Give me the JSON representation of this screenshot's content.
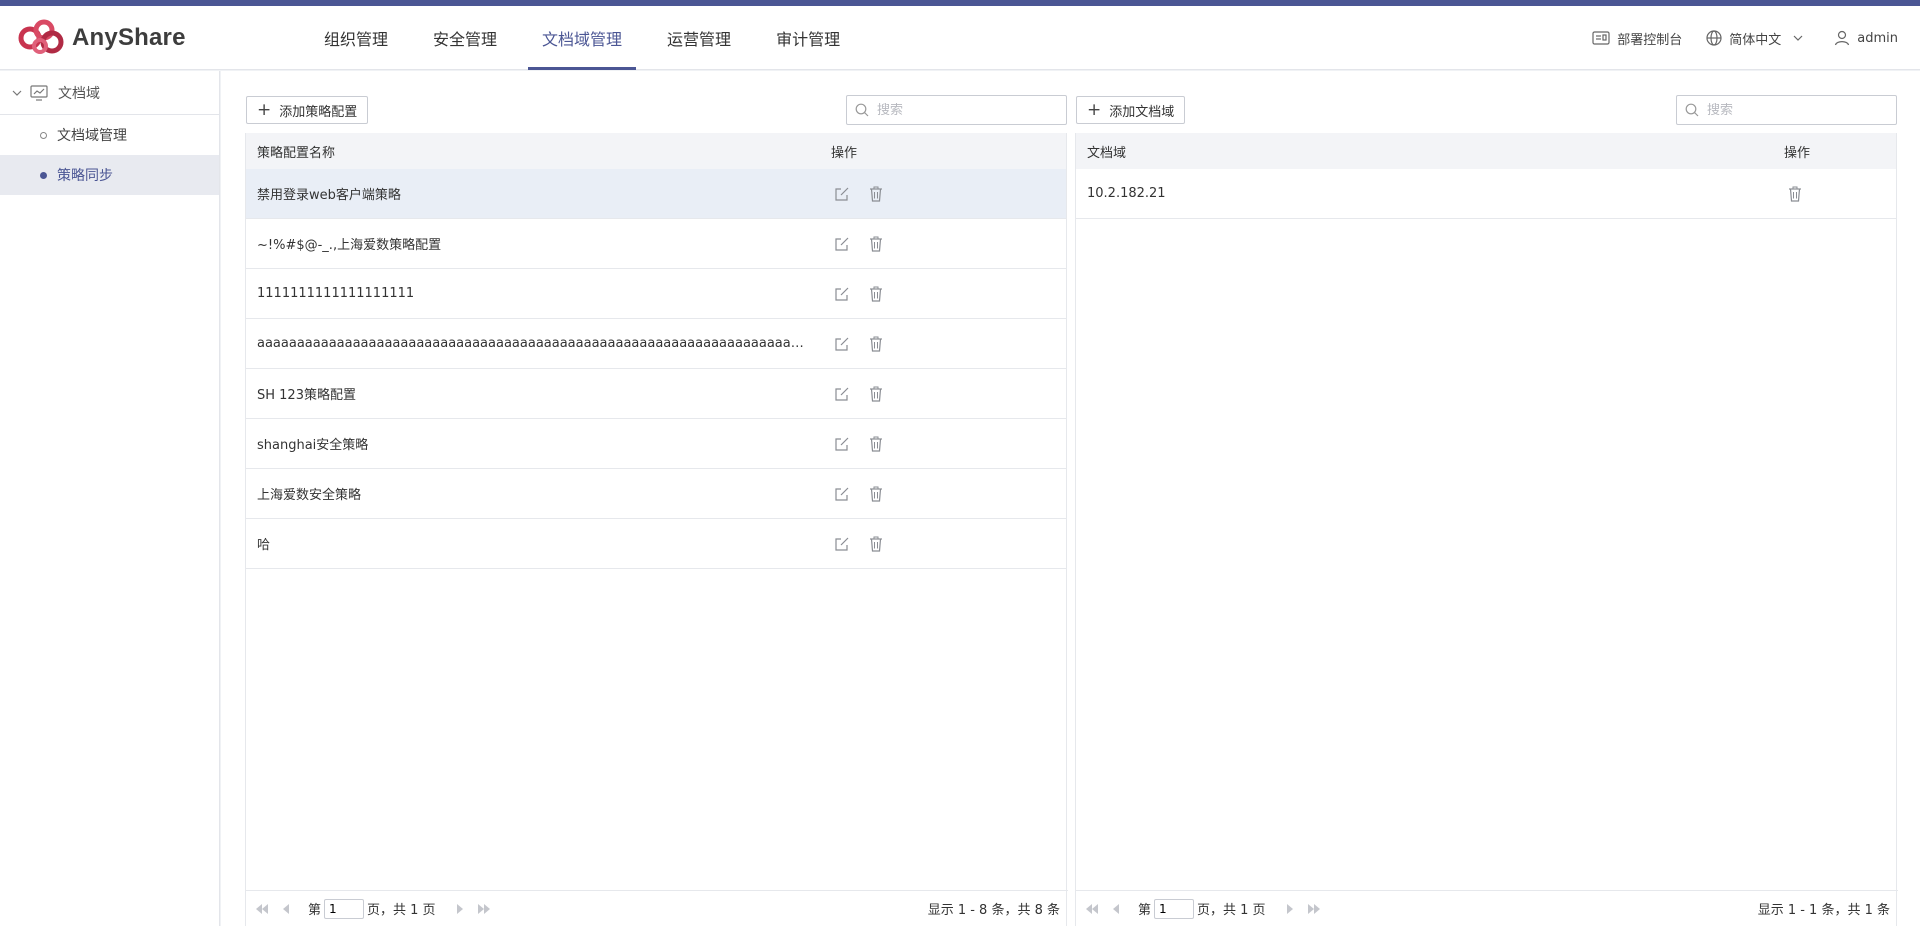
{
  "app": {
    "name": "AnyShare"
  },
  "nav": {
    "items": [
      {
        "label": "组织管理"
      },
      {
        "label": "安全管理"
      },
      {
        "label": "文档域管理",
        "active": true
      },
      {
        "label": "运营管理"
      },
      {
        "label": "审计管理"
      }
    ]
  },
  "header_right": {
    "console": "部署控制台",
    "language": "简体中文",
    "user": "admin"
  },
  "sidebar": {
    "root": "文档域",
    "items": [
      {
        "label": "文档域管理"
      },
      {
        "label": "策略同步",
        "active": true
      }
    ]
  },
  "left_panel": {
    "add_button": "添加策略配置",
    "search_placeholder": "搜索",
    "columns": {
      "name": "策略配置名称",
      "ops": "操作"
    },
    "rows": [
      {
        "name": "禁用登录web客户端策略",
        "selected": true
      },
      {
        "name": "~!%#$@-_.,上海爱数策略配置"
      },
      {
        "name": "1111111111111111111"
      },
      {
        "name": "aaaaaaaaaaaaaaaaaaaaaaaaaaaaaaaaaaaaaaaaaaaaaaaaaaaaaaaaaaaaaaaaaaaaaaaaaaaaaaaaaaaaaaaaaaaaaaaaaaaaa"
      },
      {
        "name": "SH  123策略配置"
      },
      {
        "name": "shanghai安全策略"
      },
      {
        "name": "上海爱数安全策略"
      },
      {
        "name": "哈"
      }
    ],
    "pager": {
      "prefix": "第",
      "page": "1",
      "suffix": "页，共 1 页",
      "summary": "显示 1 - 8 条，共 8 条"
    }
  },
  "right_panel": {
    "add_button": "添加文档域",
    "search_placeholder": "搜索",
    "columns": {
      "name": "文档域",
      "ops": "操作"
    },
    "rows": [
      {
        "name": "10.2.182.21"
      }
    ],
    "pager": {
      "prefix": "第",
      "page": "1",
      "suffix": "页，共 1 页",
      "summary": "显示 1 - 1 条，共 1 条"
    }
  },
  "colors": {
    "accent": "#4b5694",
    "logo": "#c8344f"
  }
}
